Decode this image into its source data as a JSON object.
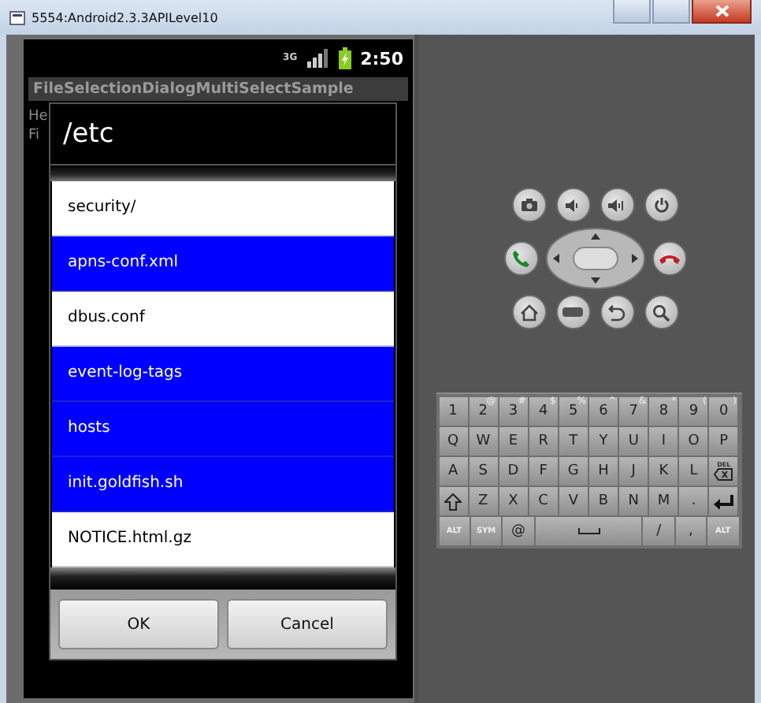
{
  "window": {
    "title": "5554:Android2.3.3APILevel10"
  },
  "status_bar": {
    "network": "3G",
    "time": "2:50"
  },
  "app": {
    "title": "FileSelectionDialogMultiSelectSample",
    "lines": [
      "He",
      "Fi"
    ]
  },
  "dialog": {
    "title": "/etc",
    "items": [
      {
        "name": "security/",
        "selected": false
      },
      {
        "name": "apns-conf.xml",
        "selected": true
      },
      {
        "name": "dbus.conf",
        "selected": false
      },
      {
        "name": "event-log-tags",
        "selected": true
      },
      {
        "name": "hosts",
        "selected": true
      },
      {
        "name": "init.goldfish.sh",
        "selected": true
      },
      {
        "name": "NOTICE.html.gz",
        "selected": false
      }
    ],
    "buttons": [
      "OK",
      "Cancel"
    ]
  },
  "keyboard": {
    "rows": [
      {
        "keys": [
          {
            "kind": "char",
            "label": "1"
          },
          {
            "kind": "char",
            "label": "2",
            "alt": "@"
          },
          {
            "kind": "char",
            "label": "3",
            "alt": "#"
          },
          {
            "kind": "char",
            "label": "4",
            "alt": "$"
          },
          {
            "kind": "char",
            "label": "5",
            "alt": "%"
          },
          {
            "kind": "char",
            "label": "6",
            "alt": "^"
          },
          {
            "kind": "char",
            "label": "7",
            "alt": "&"
          },
          {
            "kind": "char",
            "label": "8",
            "alt": "*"
          },
          {
            "kind": "char",
            "label": "9",
            "alt": "("
          },
          {
            "kind": "char",
            "label": "0",
            "alt": ")"
          }
        ]
      },
      {
        "keys": [
          {
            "kind": "char",
            "label": "Q"
          },
          {
            "kind": "char",
            "label": "W"
          },
          {
            "kind": "char",
            "label": "E"
          },
          {
            "kind": "char",
            "label": "R"
          },
          {
            "kind": "char",
            "label": "T"
          },
          {
            "kind": "char",
            "label": "Y"
          },
          {
            "kind": "char",
            "label": "U"
          },
          {
            "kind": "char",
            "label": "I"
          },
          {
            "kind": "char",
            "label": "O"
          },
          {
            "kind": "char",
            "label": "P"
          }
        ]
      },
      {
        "keys": [
          {
            "kind": "char",
            "label": "A"
          },
          {
            "kind": "char",
            "label": "S"
          },
          {
            "kind": "char",
            "label": "D"
          },
          {
            "kind": "char",
            "label": "F"
          },
          {
            "kind": "char",
            "label": "G"
          },
          {
            "kind": "char",
            "label": "H"
          },
          {
            "kind": "char",
            "label": "J"
          },
          {
            "kind": "char",
            "label": "K"
          },
          {
            "kind": "char",
            "label": "L"
          },
          {
            "kind": "delete",
            "label": "DEL"
          }
        ]
      },
      {
        "keys": [
          {
            "kind": "shift"
          },
          {
            "kind": "char",
            "label": "Z"
          },
          {
            "kind": "char",
            "label": "X"
          },
          {
            "kind": "char",
            "label": "C"
          },
          {
            "kind": "char",
            "label": "V"
          },
          {
            "kind": "char",
            "label": "B"
          },
          {
            "kind": "char",
            "label": "N"
          },
          {
            "kind": "char",
            "label": "M"
          },
          {
            "kind": "char",
            "label": "."
          },
          {
            "kind": "enter"
          }
        ]
      },
      {
        "keys": [
          {
            "kind": "small",
            "label": "ALT"
          },
          {
            "kind": "small",
            "label": "SYM"
          },
          {
            "kind": "char",
            "label": "@"
          },
          {
            "kind": "space"
          },
          {
            "kind": "char",
            "label": "/"
          },
          {
            "kind": "char",
            "label": ","
          },
          {
            "kind": "small",
            "label": "ALT"
          }
        ]
      }
    ]
  }
}
